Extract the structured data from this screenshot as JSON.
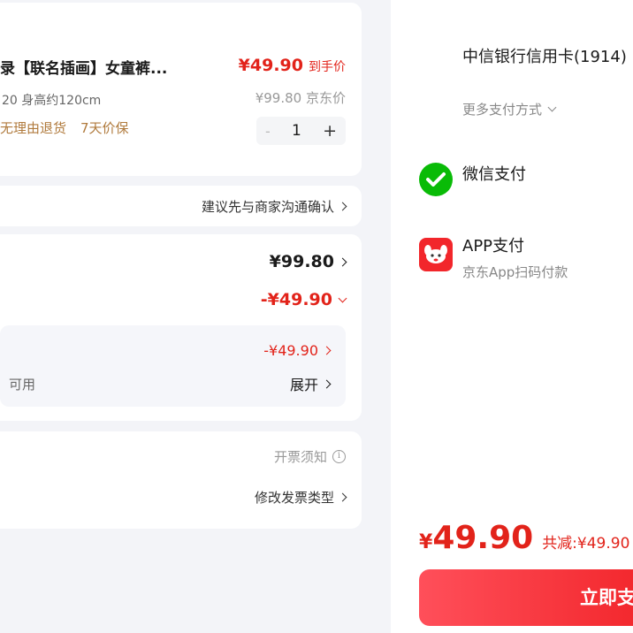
{
  "product": {
    "title": "录【联名插画】女童裤...",
    "spec": "20 身高约120cm",
    "tags": [
      "无理由退货",
      "7天价保"
    ],
    "price": "¥49.90",
    "price_label": "到手价",
    "original_price": "¥99.80",
    "original_label": "京东价",
    "quantity_minus": "-",
    "quantity": "1",
    "quantity_plus": "+"
  },
  "note": {
    "text": "建议先与商家沟通确认"
  },
  "price_detail": {
    "total": "¥99.80",
    "discount": "-¥49.90",
    "coupon_amount": "-¥49.90",
    "coupon_left_text": "可用",
    "expand_label": "展开"
  },
  "invoice": {
    "notice": "开票须知",
    "modify_type": "修改发票类型"
  },
  "payment": {
    "bank_card": "中信银行信用卡(1914)",
    "more_methods": "更多支付方式",
    "wechat": "微信支付",
    "app_pay": "APP支付",
    "app_pay_sub": "京东App扫码付款"
  },
  "checkout": {
    "currency": "¥",
    "total": "49.90",
    "saved": "共减:¥49.90",
    "pay_button": "立即支付"
  },
  "colors": {
    "accent_red": "#e2231a",
    "wechat_green": "#09bb07",
    "tag_brown": "#b07a3c"
  }
}
